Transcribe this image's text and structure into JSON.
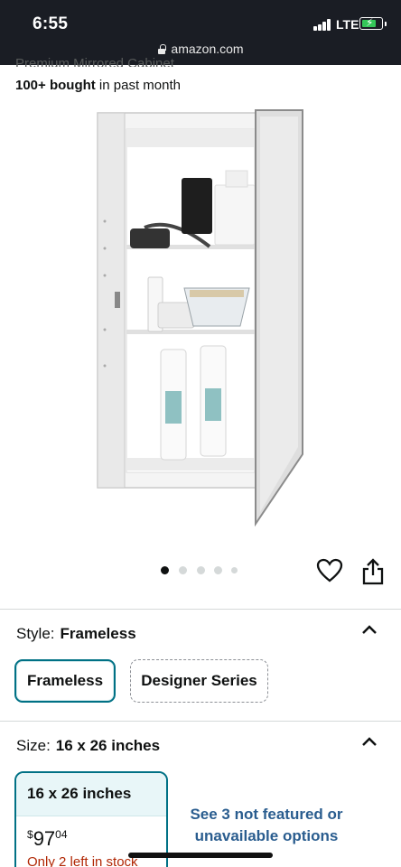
{
  "status_bar": {
    "time": "6:55",
    "network": "LTE",
    "url": "amazon.com"
  },
  "product": {
    "title_fragment": "Premium Mirrored Cabinet",
    "bought_bold": "100+ bought",
    "bought_rest": " in past month",
    "carousel": {
      "count": 5,
      "active_index": 0
    }
  },
  "style": {
    "label": "Style:",
    "selected": "Frameless",
    "options": [
      "Frameless",
      "Designer Series"
    ]
  },
  "size": {
    "label": "Size:",
    "selected": "16 x 26 inches",
    "card": {
      "name": "16 x 26 inches",
      "price_symbol": "$",
      "price_dollars": "97",
      "price_cents": "04",
      "stock": "Only 2 left in stock"
    },
    "not_featured": "See 3 not featured or unavailable options"
  },
  "icons": {
    "wishlist": "heart-icon",
    "share": "share-icon",
    "expand": "chevron-up-icon",
    "lock": "lock-icon"
  },
  "colors": {
    "accent": "#007185",
    "stock": "#b12704",
    "link": "#2a5d8f"
  }
}
